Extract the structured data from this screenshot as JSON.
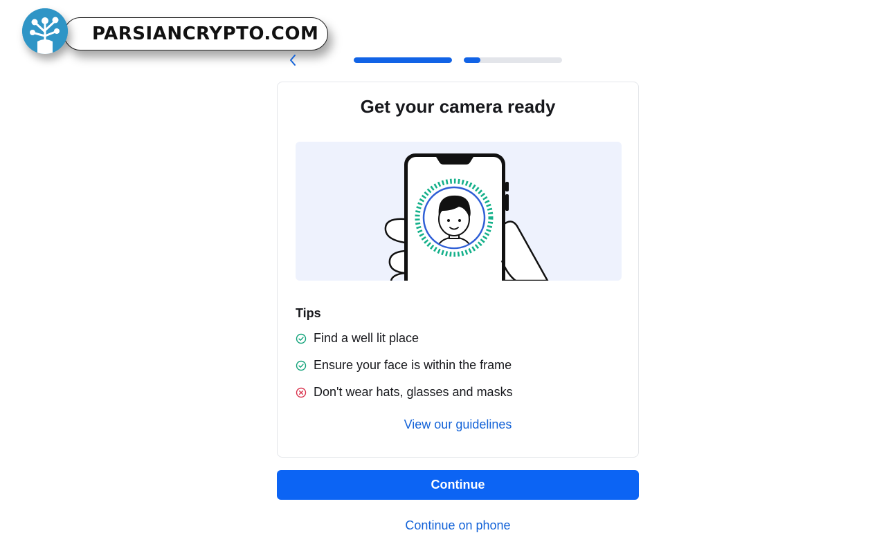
{
  "watermark": {
    "text": "PARSIANCRYPTO.COM"
  },
  "nav": {
    "back_icon": "chevron-left-icon",
    "progress": [
      {
        "fill": 1.0
      },
      {
        "fill": 0.17
      }
    ]
  },
  "card": {
    "title": "Get your camera ready",
    "illustration": "phone-selfie-illustration",
    "tips_heading": "Tips",
    "tips": [
      {
        "text": "Find a well lit place",
        "status": "ok",
        "icon": "check-circle-icon"
      },
      {
        "text": "Ensure your face is within the frame",
        "status": "ok",
        "icon": "check-circle-icon"
      },
      {
        "text": "Don't wear hats, glasses and masks",
        "status": "error",
        "icon": "x-circle-icon"
      }
    ],
    "guidelines_link": "View our guidelines"
  },
  "actions": {
    "continue_label": "Continue",
    "phone_label": "Continue on phone"
  },
  "colors": {
    "accent": "#0c64f4",
    "link": "#1463d8",
    "success": "#12a37a",
    "error": "#d9334d",
    "illustration_bg": "#eef2fd"
  }
}
